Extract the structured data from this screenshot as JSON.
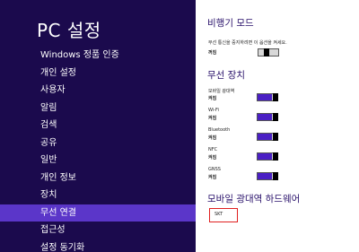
{
  "sidebar": {
    "title": "PC 설정",
    "items": [
      {
        "label": "Windows 정품 인증"
      },
      {
        "label": "개인 설정"
      },
      {
        "label": "사용자"
      },
      {
        "label": "알림"
      },
      {
        "label": "검색"
      },
      {
        "label": "공유"
      },
      {
        "label": "일반"
      },
      {
        "label": "개인 정보"
      },
      {
        "label": "장치"
      },
      {
        "label": "무선 연결",
        "selected": true
      },
      {
        "label": "접근성"
      },
      {
        "label": "설정 동기화"
      }
    ]
  },
  "airplane": {
    "title": "비행기 모드",
    "description": "무선 통신을 중지하려면 이 옵션을 켜세요.",
    "state": "꺼짐"
  },
  "wireless": {
    "title": "무선 장치",
    "devices": [
      {
        "name": "모바일 광대역",
        "state": "켜짐"
      },
      {
        "name": "Wi-Fi",
        "state": "켜짐"
      },
      {
        "name": "Bluetooth",
        "state": "켜짐"
      },
      {
        "name": "NFC",
        "state": "켜짐"
      },
      {
        "name": "GNSS",
        "state": "켜짐"
      }
    ]
  },
  "hardware": {
    "title": "모바일 광대역 하드웨어",
    "operator": "SKT"
  },
  "colors": {
    "sidebar_bg": "#1b0a4d",
    "selected_bg": "#5b36c9",
    "toggle_on": "#4a1fc4",
    "highlight_box": "#e02020"
  }
}
